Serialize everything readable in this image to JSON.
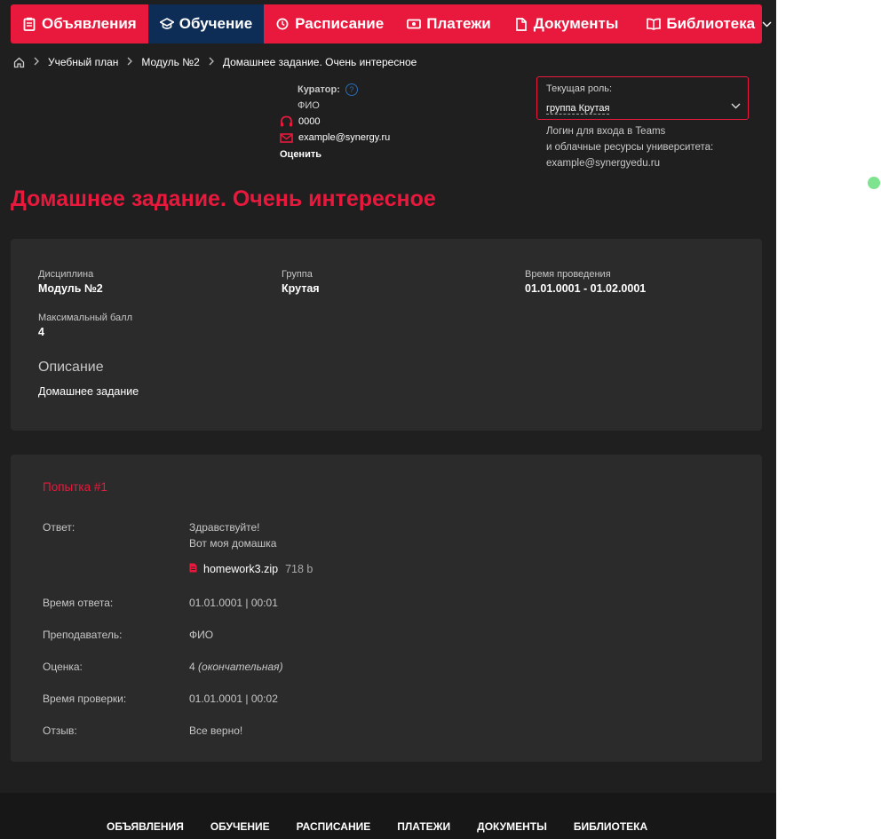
{
  "nav": {
    "items": [
      {
        "label": "Объявления",
        "icon": "clipboard-icon"
      },
      {
        "label": "Обучение",
        "icon": "graduation-cap-icon",
        "active": true
      },
      {
        "label": "Расписание",
        "icon": "clock-icon"
      },
      {
        "label": "Платежи",
        "icon": "money-icon"
      },
      {
        "label": "Документы",
        "icon": "document-icon"
      },
      {
        "label": "Библиотека",
        "icon": "book-icon",
        "dropdown": true
      }
    ]
  },
  "breadcrumb": [
    "Учебный план",
    "Модуль №2",
    "Домашнее задание. Очень интересное"
  ],
  "curator": {
    "label": "Куратор:",
    "name": "ФИО",
    "phone": "0000",
    "email": "example@synergy.ru",
    "rate": "Оценить"
  },
  "role": {
    "label": "Текущая роль:",
    "value": "группа Крутая"
  },
  "login": {
    "line1": "Логин для входа в Teams",
    "line2": "и облачные ресурсы университета:",
    "email": "example@synergyedu.ru"
  },
  "page_title": "Домашнее задание. Очень интересное",
  "info": {
    "discipline_label": "Дисциплина",
    "discipline": "Модуль №2",
    "group_label": "Группа",
    "group": "Крутая",
    "time_label": "Время проведения",
    "time": "01.01.0001 - 01.02.0001",
    "max_label": "Максимальный балл",
    "max": "4",
    "desc_label": "Описание",
    "desc": "Домашнее задание"
  },
  "attempt": {
    "title": "Попытка #1",
    "answer_label": "Ответ:",
    "answer_line1": "Здравствуйте!",
    "answer_line2": "Вот моя домашка",
    "file_name": "homework3.zip",
    "file_size": "718 b",
    "answer_time_label": "Время ответа:",
    "answer_time": "01.01.0001 | 00:01",
    "teacher_label": "Преподаватель:",
    "teacher": "ФИО",
    "grade_label": "Оценка:",
    "grade": "4",
    "grade_note": "(окончательная)",
    "check_time_label": "Время проверки:",
    "check_time": "01.01.0001 | 00:02",
    "review_label": "Отзыв:",
    "review": "Все верно!"
  },
  "footer": [
    "ОБЪЯВЛЕНИЯ",
    "ОБУЧЕНИЕ",
    "РАСПИСАНИЕ",
    "ПЛАТЕЖИ",
    "ДОКУМЕНТЫ",
    "БИБЛИОТЕКА"
  ],
  "colors": {
    "accent": "#e8193d",
    "active_nav": "#0d2d57",
    "bg": "#1f1f1f",
    "card": "#2b2b2b"
  }
}
